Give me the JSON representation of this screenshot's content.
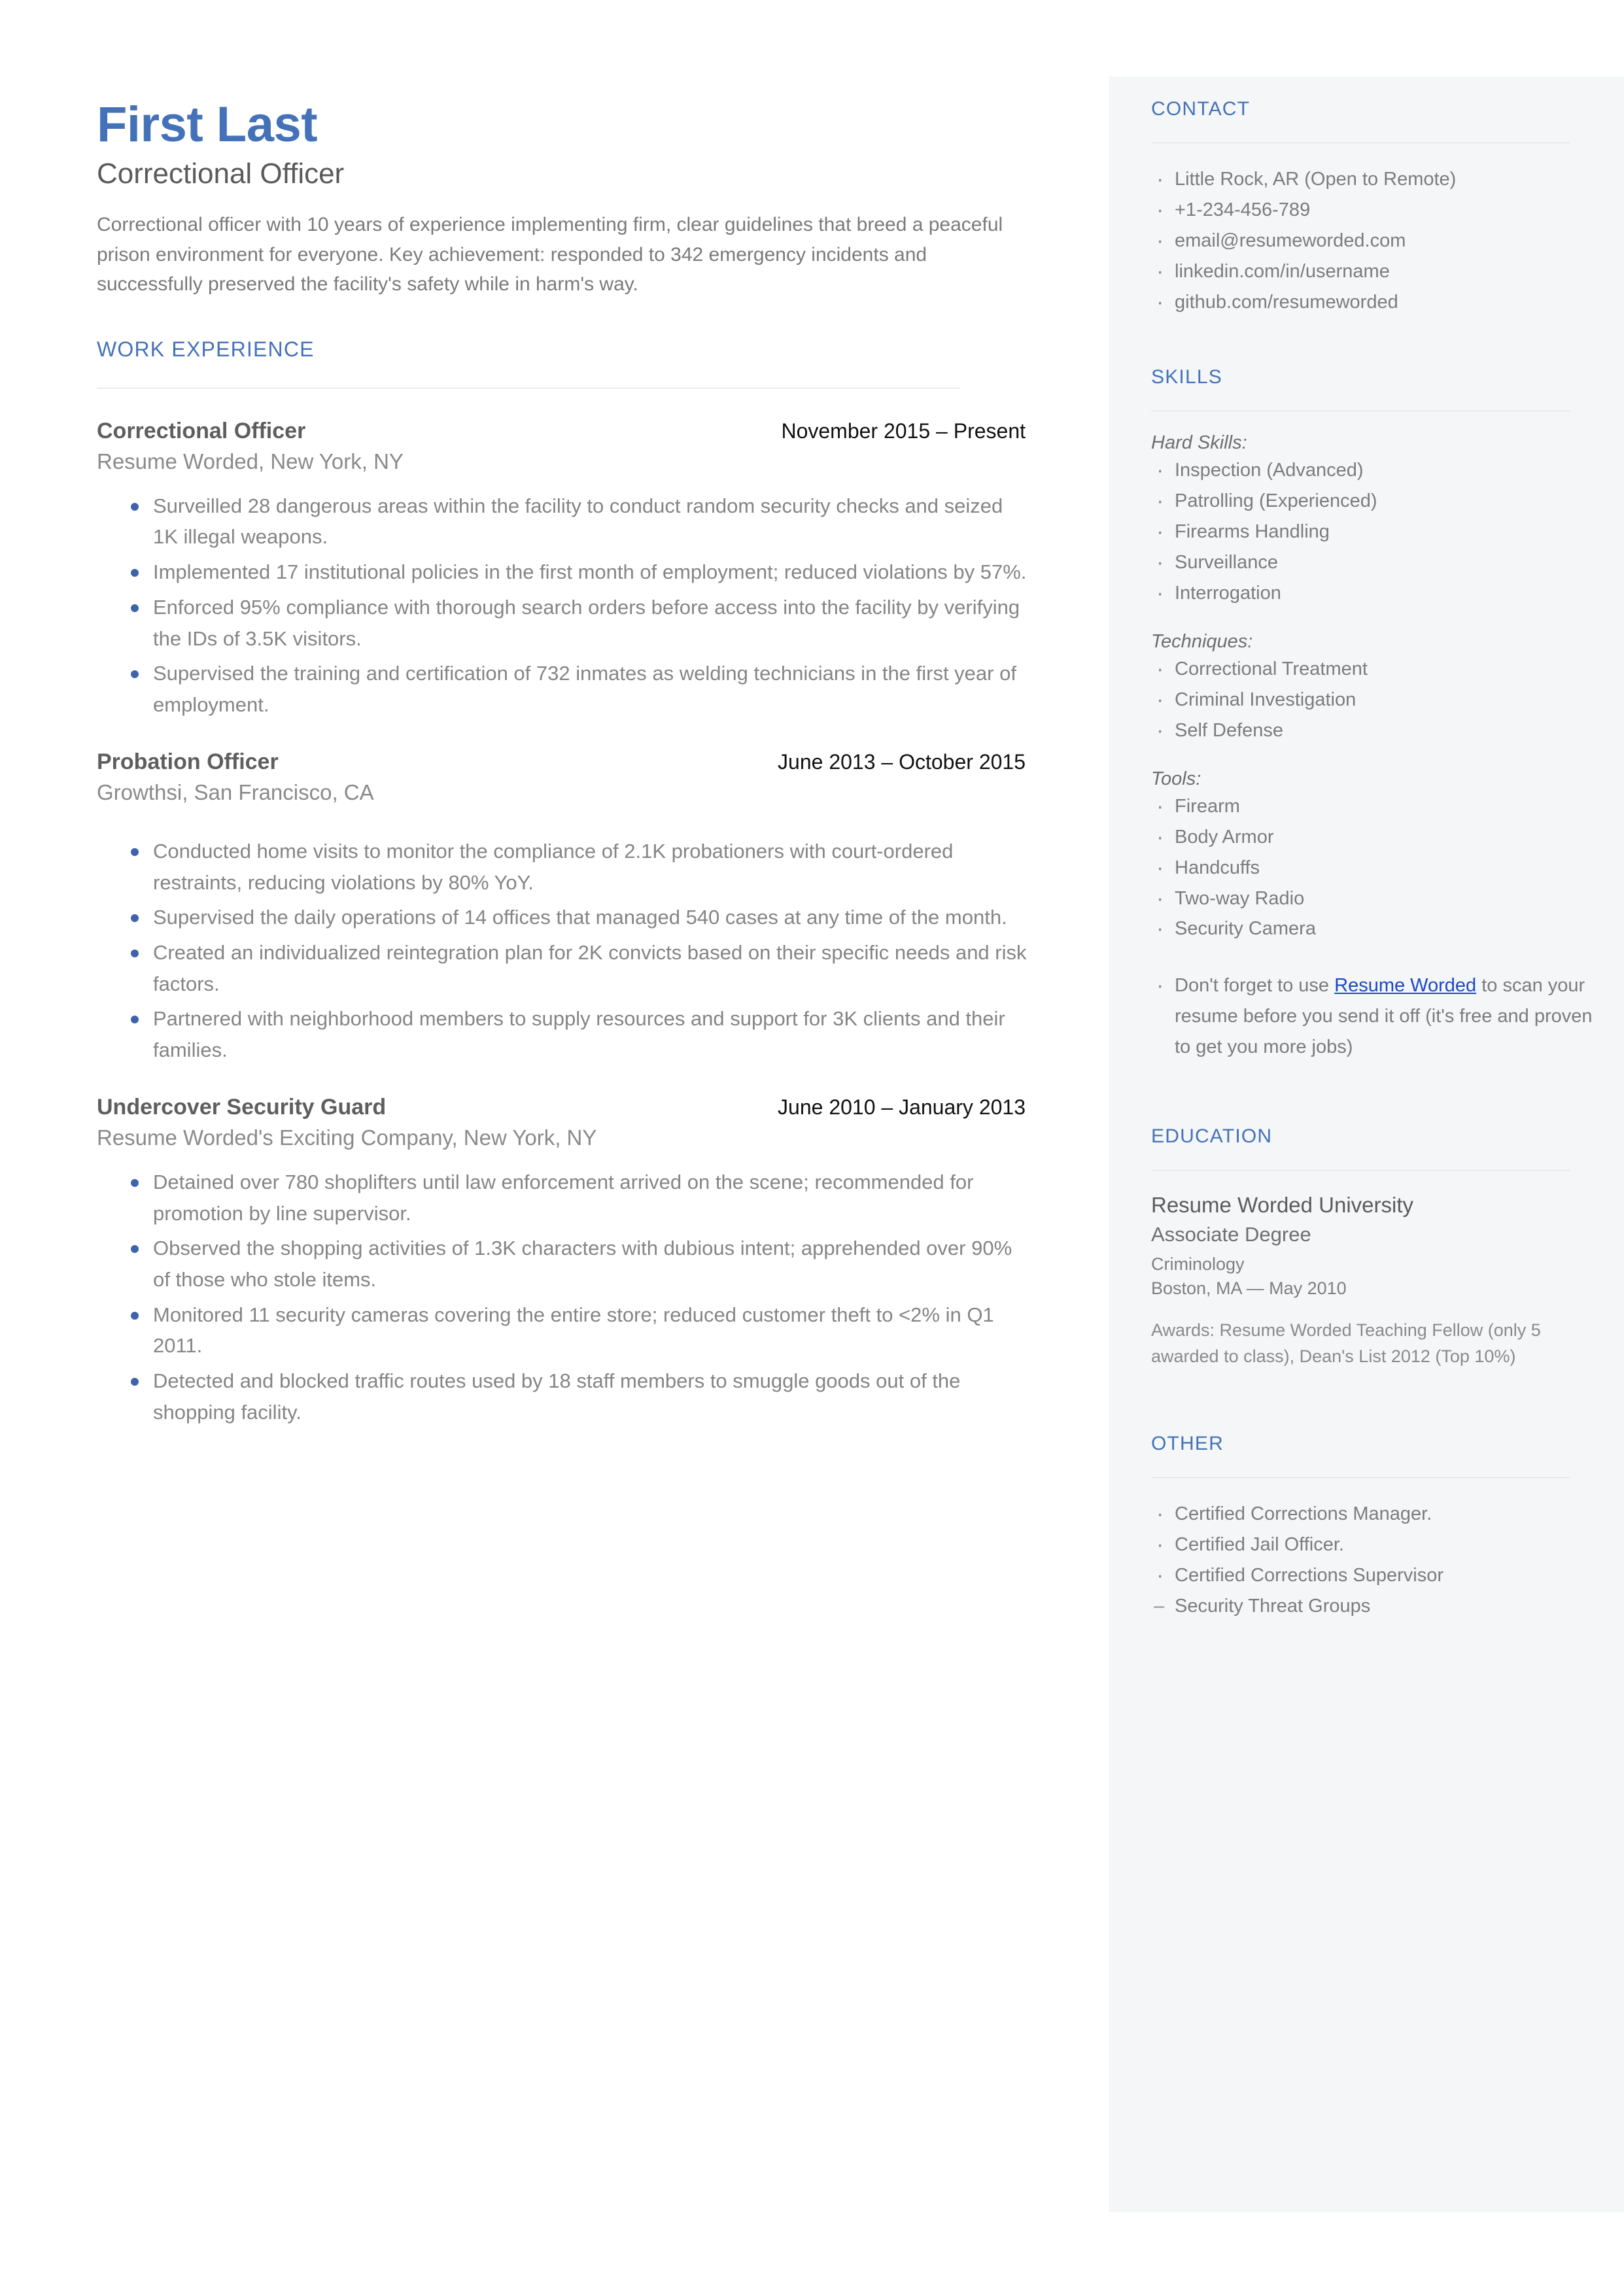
{
  "accent_color": "#4472b8",
  "link_color": "#1a49c4",
  "sidebar_bg": "#f4f6f8",
  "header": {
    "name": "First Last",
    "headline": "Correctional Officer",
    "summary": "Correctional officer with 10 years of experience implementing firm, clear guidelines that breed a peaceful prison environment for everyone. Key achievement: responded to 342 emergency incidents and successfully preserved the facility's safety while in harm's way."
  },
  "work": {
    "heading": "WORK EXPERIENCE",
    "jobs": [
      {
        "title": "Correctional Officer",
        "dates": "November 2015 – Present",
        "company": "Resume Worded, New York, NY",
        "bullets": [
          "Surveilled 28 dangerous areas within the facility to conduct random security checks and seized 1K illegal weapons.",
          "Implemented 17 institutional policies in the first month of employment; reduced violations by 57%.",
          "Enforced 95% compliance with thorough search orders before access into the facility by verifying the IDs of 3.5K visitors.",
          "Supervised the training and certification of 732 inmates as welding technicians in the first year of employment."
        ]
      },
      {
        "title": "Probation Officer",
        "dates": "June 2013 – October 2015",
        "company": "Growthsi, San Francisco, CA",
        "bullets": [
          "Conducted home visits to monitor the compliance of 2.1K probationers with court-ordered restraints, reducing violations by 80% YoY.",
          "Supervised the daily operations of 14 offices that managed 540 cases at any time of the month.",
          "Created an individualized reintegration plan for 2K convicts based on their specific needs and risk factors.",
          "Partnered with neighborhood members to supply resources and support for 3K clients and their families."
        ]
      },
      {
        "title": "Undercover Security Guard",
        "dates": "June 2010 – January 2013",
        "company": "Resume Worded's Exciting Company, New York, NY",
        "bullets": [
          "Detained over 780 shoplifters until law enforcement arrived on the scene; recommended for promotion by line supervisor.",
          "Observed the shopping activities of 1.3K characters with dubious intent; apprehended over 90% of those who stole items.",
          "Monitored 11 security cameras covering the entire store; reduced customer theft to <2% in Q1 2011.",
          "Detected and blocked traffic routes used by 18 staff members to smuggle goods out of the shopping facility."
        ]
      }
    ]
  },
  "contact": {
    "heading": "CONTACT",
    "items": [
      "Little Rock, AR (Open to Remote)",
      "+1-234-456-789",
      "email@resumeworded.com",
      "linkedin.com/in/username",
      "github.com/resumeworded"
    ]
  },
  "skills": {
    "heading": "SKILLS",
    "groups": [
      {
        "label": "Hard Skills:",
        "items": [
          "Inspection (Advanced)",
          "Patrolling (Experienced)",
          "Firearms Handling",
          "Surveillance",
          "Interrogation"
        ]
      },
      {
        "label": "Techniques:",
        "items": [
          "Correctional Treatment",
          "Criminal Investigation",
          "Self Defense"
        ]
      },
      {
        "label": "Tools:",
        "items": [
          "Firearm",
          "Body Armor",
          "Handcuffs",
          "Two-way Radio",
          "Security Camera"
        ]
      }
    ],
    "promo": {
      "before": "Don't forget to use ",
      "link": "Resume Worded",
      "after": " to scan your resume before you send it off (it's free and proven to get you more jobs)"
    }
  },
  "education": {
    "heading": "EDUCATION",
    "school": "Resume Worded University",
    "degree": "Associate Degree",
    "field": "Criminology",
    "location_date": "Boston, MA — May 2010",
    "awards": "Awards: Resume Worded Teaching Fellow (only 5 awarded to class), Dean's List 2012 (Top 10%)"
  },
  "other": {
    "heading": "OTHER",
    "items": [
      "Certified Corrections Manager.",
      "Certified Jail Officer.",
      "Certified Corrections Supervisor"
    ],
    "continuation": "Security Threat Groups"
  }
}
